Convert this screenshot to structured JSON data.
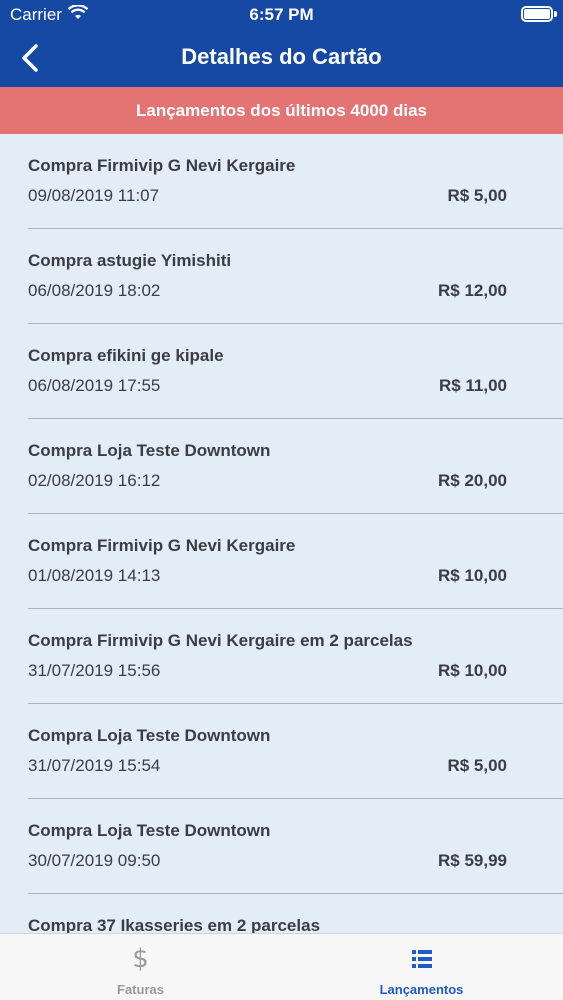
{
  "status_bar": {
    "carrier": "Carrier",
    "time": "6:57 PM"
  },
  "nav": {
    "title": "Detalhes do Cartão",
    "back_icon": "chevron-left-icon"
  },
  "banner": {
    "text": "Lançamentos dos últimos 4000 dias"
  },
  "transactions": [
    {
      "title": "Compra Firmivip G Nevi Kergaire",
      "datetime": "09/08/2019 11:07",
      "value": "R$ 5,00"
    },
    {
      "title": "Compra astugie Yimishiti",
      "datetime": "06/08/2019 18:02",
      "value": "R$ 12,00"
    },
    {
      "title": "Compra efikini ge kipale",
      "datetime": "06/08/2019 17:55",
      "value": "R$ 11,00"
    },
    {
      "title": "Compra Loja Teste Downtown",
      "datetime": "02/08/2019 16:12",
      "value": "R$ 20,00"
    },
    {
      "title": "Compra Firmivip G Nevi Kergaire",
      "datetime": "01/08/2019 14:13",
      "value": "R$ 10,00"
    },
    {
      "title": "Compra Firmivip G Nevi Kergaire em 2 parcelas",
      "datetime": "31/07/2019 15:56",
      "value": "R$ 10,00"
    },
    {
      "title": "Compra Loja Teste Downtown",
      "datetime": "31/07/2019 15:54",
      "value": "R$ 5,00"
    },
    {
      "title": "Compra Loja Teste Downtown",
      "datetime": "30/07/2019 09:50",
      "value": "R$ 59,99"
    },
    {
      "title": "Compra 37 Ikasseries em 2 parcelas",
      "datetime": "",
      "value": ""
    }
  ],
  "tabbar": {
    "tabs": [
      {
        "label": "Faturas",
        "icon": "dollar-icon",
        "active": false
      },
      {
        "label": "Lançamentos",
        "icon": "list-icon",
        "active": true
      }
    ]
  },
  "colors": {
    "primary": "#1549a3",
    "banner": "#e47373",
    "background": "#e3edf8",
    "active_tab": "#1e5bc6"
  }
}
